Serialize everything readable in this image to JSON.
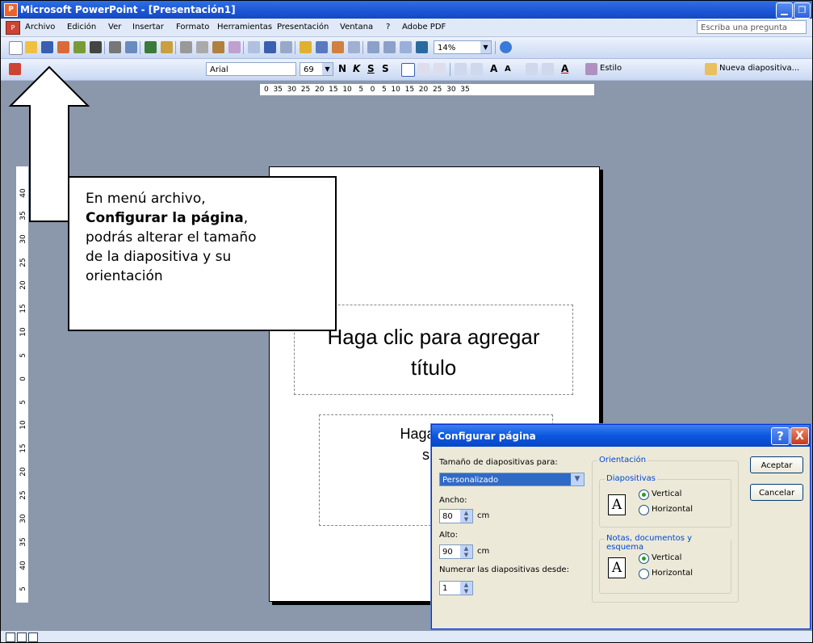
{
  "window": {
    "title": "Microsoft PowerPoint - [Presentación1]",
    "app_icon": "powerpoint-icon"
  },
  "menubar": {
    "items": [
      "Archivo",
      "Edición",
      "Ver",
      "Insertar",
      "Formato",
      "Herramientas",
      "Presentación",
      "Ventana",
      "?",
      "Adobe PDF"
    ],
    "ask_placeholder": "Escriba una pregunta"
  },
  "toolbar": {
    "zoom": "14%"
  },
  "format_toolbar": {
    "font": "Arial",
    "size": "69",
    "bold": "N",
    "italic": "K",
    "underline": "S",
    "shadow": "S",
    "grow_font": "A",
    "shrink_font": "A",
    "font_color": "A",
    "style": "Estilo",
    "new_slide": "Nueva diapositiva..."
  },
  "ruler": {
    "horizontal": "0  35  30  25  20  15  10   5   0   5  10  15  20  25  30  35",
    "vertical": [
      "40",
      "35",
      "30",
      "25",
      "20",
      "15",
      "10",
      "5",
      "0",
      "5",
      "10",
      "15",
      "20",
      "25",
      "30",
      "35",
      "40",
      "5"
    ]
  },
  "slide": {
    "title_placeholder": [
      "Haga clic para agregar",
      "título"
    ],
    "subtitle_placeholder": [
      "Haga clic p",
      "subt"
    ]
  },
  "callout": {
    "line1": "En menú archivo,",
    "bold": "Configurar la página",
    "after_bold": ",",
    "rest": [
      "podrás alterar el tamaño",
      "de la diapositiva y su",
      "orientación"
    ]
  },
  "dialog": {
    "title": "Configurar página",
    "size_label": "Tamaño de diapositivas para:",
    "size_value": "Personalizado",
    "width_label": "Ancho:",
    "width_value": "80",
    "height_label": "Alto:",
    "height_value": "90",
    "unit": "cm",
    "number_label": "Numerar las diapositivas desde:",
    "number_value": "1",
    "orientation_label": "Orientación",
    "slides_group": "Diapositivas",
    "notes_group": "Notas, documentos y esquema",
    "vertical": "Vertical",
    "horizontal": "Horizontal",
    "slides_orientation": "Vertical",
    "notes_orientation": "Vertical",
    "ok": "Aceptar",
    "cancel": "Cancelar",
    "help": "?",
    "close": "X",
    "page_icon_letter": "A"
  }
}
